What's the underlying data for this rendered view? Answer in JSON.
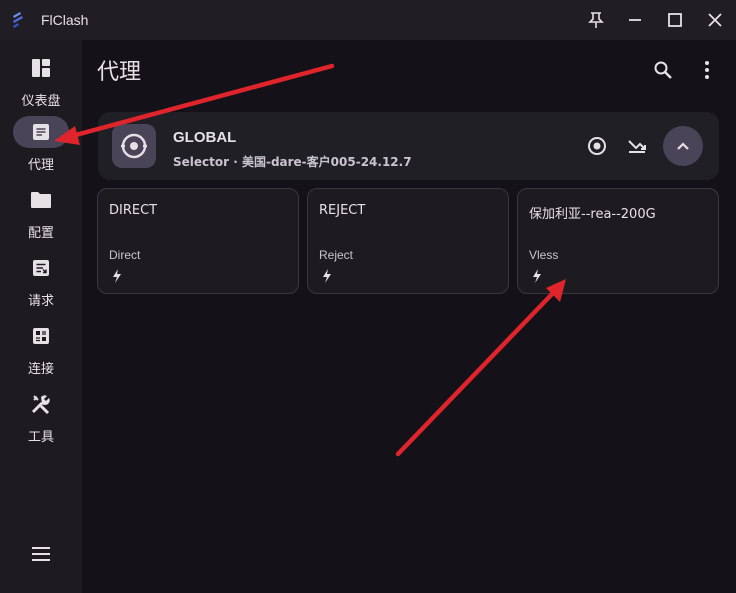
{
  "window": {
    "title": "FlClash",
    "controls": [
      "pin-icon",
      "minimize-icon",
      "maximize-icon",
      "close-icon"
    ]
  },
  "sidebar": {
    "items": [
      {
        "label": "仪表盘",
        "icon": "dashboard-icon",
        "active": false
      },
      {
        "label": "代理",
        "icon": "proxy-list-icon",
        "active": true
      },
      {
        "label": "配置",
        "icon": "folder-icon",
        "active": false
      },
      {
        "label": "请求",
        "icon": "request-icon",
        "active": false
      },
      {
        "label": "连接",
        "icon": "connections-icon",
        "active": false
      },
      {
        "label": "工具",
        "icon": "tools-icon",
        "active": false
      }
    ],
    "menu_icon": "hamburger-menu-icon"
  },
  "header": {
    "title": "代理",
    "actions": [
      "search-icon",
      "more-vert-icon"
    ]
  },
  "group": {
    "name": "GLOBAL",
    "subtitle": "Selector · 美国-dare-客户005-24.12.7",
    "actions": [
      "locate-icon",
      "test-latency-icon",
      "collapse-icon"
    ]
  },
  "proxies": [
    {
      "name": "DIRECT",
      "type": "Direct"
    },
    {
      "name": "REJECT",
      "type": "Reject"
    },
    {
      "name": "保加利亚--rea--200G",
      "type": "Vless"
    }
  ],
  "colors": {
    "background": "#141218",
    "sidebar": "#1d1b20",
    "accent": "#4a4458",
    "annotation_arrow": "#e0242b"
  }
}
